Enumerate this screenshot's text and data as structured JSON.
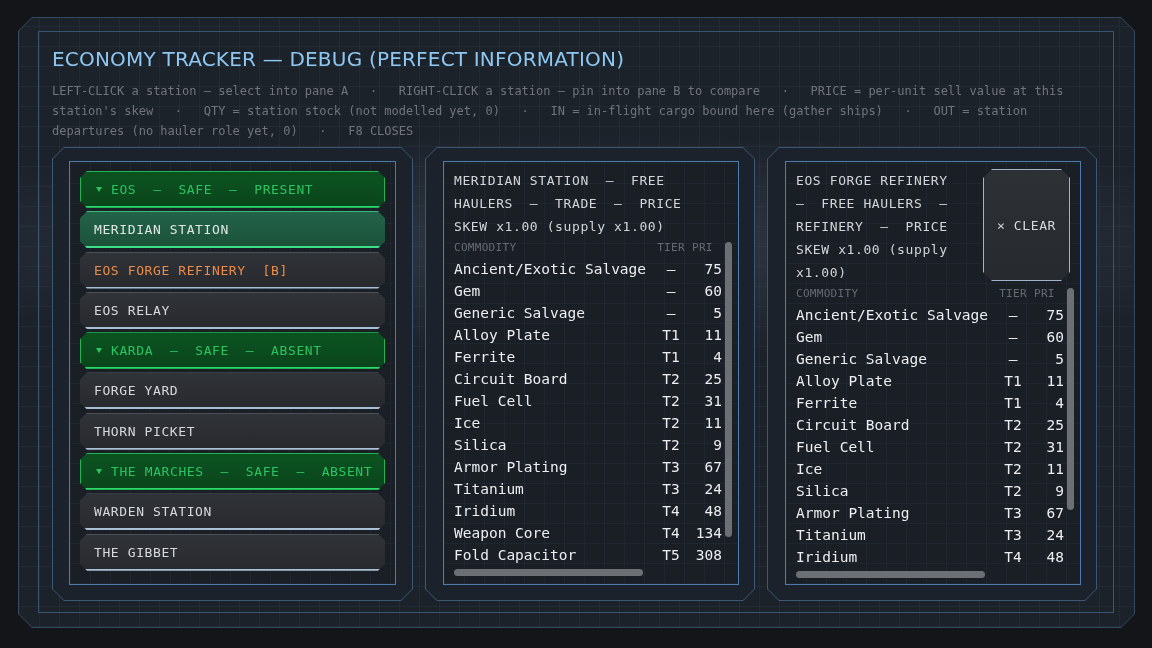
{
  "window": {
    "title": "ECONOMY TRACKER — DEBUG (PERFECT INFORMATION)",
    "help_text": "LEFT-CLICK a station — select into pane A   ·   RIGHT-CLICK a station — pin into pane B to compare   ·   PRICE = per-unit sell value at this station's skew   ·   QTY = station stock (not modelled yet, 0)   ·   IN = in-flight cargo bound here (gather ships)   ·   OUT = station departures (no hauler role yet, 0)   ·   F8 CLOSES"
  },
  "station_list": {
    "groups": [
      {
        "label": "EOS  —  SAFE  —  PRESENT",
        "expanded": true,
        "stations": [
          {
            "name": "MERIDIAN STATION",
            "selected": true,
            "pinned": false
          },
          {
            "name": "EOS FORGE REFINERY  [B]",
            "selected": false,
            "pinned": true
          },
          {
            "name": "EOS RELAY",
            "selected": false,
            "pinned": false
          }
        ]
      },
      {
        "label": "KARDA  —  SAFE  —  ABSENT",
        "expanded": true,
        "stations": [
          {
            "name": "FORGE YARD",
            "selected": false,
            "pinned": false
          },
          {
            "name": "THORN PICKET",
            "selected": false,
            "pinned": false
          }
        ]
      },
      {
        "label": "THE MARCHES  —  SAFE  —  ABSENT",
        "expanded": true,
        "stations": [
          {
            "name": "WARDEN STATION",
            "selected": false,
            "pinned": false
          },
          {
            "name": "THE GIBBET",
            "selected": false,
            "pinned": false
          }
        ]
      }
    ]
  },
  "panes": [
    {
      "title": "MERIDIAN STATION  —  FREE HAULERS  —  TRADE  —  PRICE SKEW x1.00 (supply x1.00)",
      "columns": [
        "COMMODITY",
        "TIER",
        "PRI"
      ],
      "rows": [
        [
          "Ancient/Exotic Salvage",
          "—",
          "75"
        ],
        [
          "Gem",
          "—",
          "60"
        ],
        [
          "Generic Salvage",
          "—",
          "5"
        ],
        [
          "Alloy Plate",
          "T1",
          "11"
        ],
        [
          "Ferrite",
          "T1",
          "4"
        ],
        [
          "Circuit Board",
          "T2",
          "25"
        ],
        [
          "Fuel Cell",
          "T2",
          "31"
        ],
        [
          "Ice",
          "T2",
          "11"
        ],
        [
          "Silica",
          "T2",
          "9"
        ],
        [
          "Armor Plating",
          "T3",
          "67"
        ],
        [
          "Titanium",
          "T3",
          "24"
        ],
        [
          "Iridium",
          "T4",
          "48"
        ],
        [
          "Weapon Core",
          "T4",
          "134"
        ],
        [
          "Fold Capacitor",
          "T5",
          "308"
        ]
      ]
    },
    {
      "title": "EOS FORGE REFINERY  —  FREE HAULERS  —  REFINERY  —  PRICE SKEW x1.00 (supply x1.00)",
      "clear_button": "× CLEAR",
      "columns": [
        "COMMODITY",
        "TIER",
        "PRI"
      ],
      "rows": [
        [
          "Ancient/Exotic Salvage",
          "—",
          "75"
        ],
        [
          "Gem",
          "—",
          "60"
        ],
        [
          "Generic Salvage",
          "—",
          "5"
        ],
        [
          "Alloy Plate",
          "T1",
          "11"
        ],
        [
          "Ferrite",
          "T1",
          "4"
        ],
        [
          "Circuit Board",
          "T2",
          "25"
        ],
        [
          "Fuel Cell",
          "T2",
          "31"
        ],
        [
          "Ice",
          "T2",
          "11"
        ],
        [
          "Silica",
          "T2",
          "9"
        ],
        [
          "Armor Plating",
          "T3",
          "67"
        ],
        [
          "Titanium",
          "T3",
          "24"
        ],
        [
          "Iridium",
          "T4",
          "48"
        ]
      ]
    }
  ]
}
